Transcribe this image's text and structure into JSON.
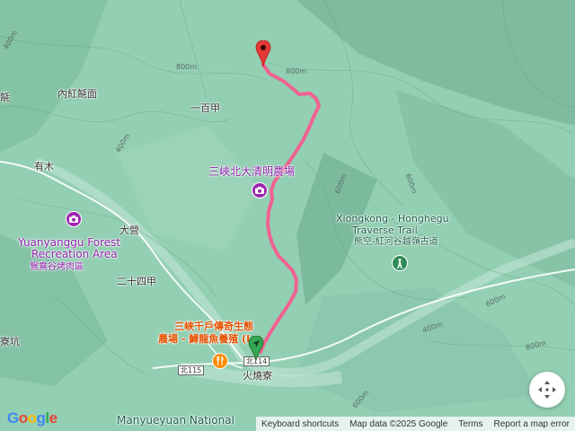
{
  "map": {
    "colors": {
      "terrain": "#8fcdb0",
      "route": "#f06292",
      "start": "#34a853",
      "end": "#e53935"
    }
  },
  "labels": {
    "neihong": "內紅毻面",
    "yibaijia": "一百甲",
    "youmu": "有木",
    "daying": "大營",
    "ershisijia": "二十四甲",
    "huoshaoliao": "火燒寮",
    "liao_keng": "寮坑",
    "ke_left": "毻"
  },
  "pois": {
    "qingming": {
      "name": "三峽北大清明農場"
    },
    "yuanyanggu": {
      "name_en": "Yuanyanggu Forest Recreation Area",
      "line1": "Yuanyanggu Forest",
      "line2": "Recreation Area",
      "name_zh": "鴛鴦谷烤肉區"
    },
    "xiongkong": {
      "line1": "Xiongkong - Honghegu",
      "line2": "Traverse Trail",
      "name_zh": "熊空-紅河谷越嶺古道"
    },
    "sanxia_farm": {
      "line1": "三峽千戶傳奇生態",
      "line2": "農場 - 鱘龍魚養殖 (I..."
    },
    "manyueyuan": {
      "name": "Manyueyuan National"
    }
  },
  "contours": [
    "800m",
    "400m",
    "600m",
    "800m",
    "600m",
    "800m",
    "400m",
    "600m",
    "400m",
    "600m"
  ],
  "roads": {
    "b115": "北115",
    "b114": "北114"
  },
  "footer": {
    "shortcuts": "Keyboard shortcuts",
    "mapdata": "Map data ©2025 Google",
    "terms": "Terms",
    "report": "Report a map error"
  },
  "logo": {
    "g1": "G",
    "g2": "o",
    "g3": "o",
    "g4": "g",
    "g5": "l",
    "g6": "e"
  }
}
